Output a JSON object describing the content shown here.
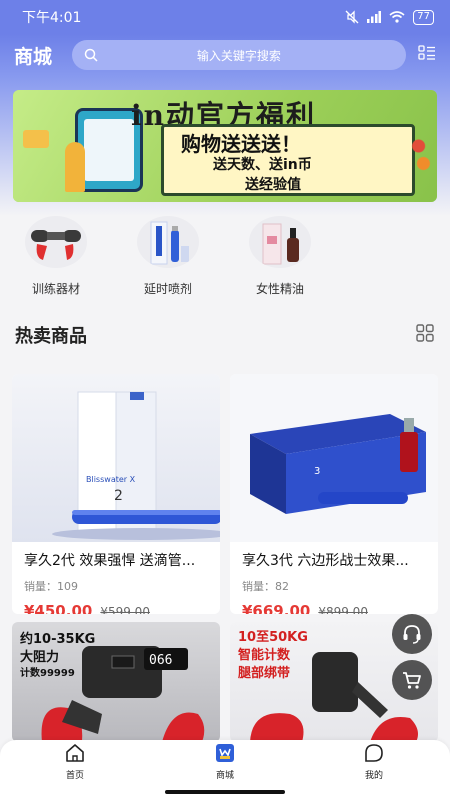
{
  "status_bar": {
    "time": "下午4:01",
    "battery": "77"
  },
  "header": {
    "title": "商城",
    "search_placeholder": "输入关键字搜索"
  },
  "banner": {
    "title": "in动官方福利",
    "line1": "购物送送送！",
    "line2": "送天数、送in币",
    "line3": "送经验值"
  },
  "categories": [
    {
      "label": "训练器材",
      "icon": "training-equipment-image"
    },
    {
      "label": "延时喷剂",
      "icon": "delay-spray-image"
    },
    {
      "label": "女性精油",
      "icon": "female-oil-image"
    }
  ],
  "section": {
    "title": "热卖商品"
  },
  "products": [
    {
      "name": "享久2代 效果强悍 送滴管...",
      "sales": "销量：109",
      "price": "¥450.00",
      "original_price": "¥599.00",
      "box_text": "Blisswater X",
      "version": "2"
    },
    {
      "name": "享久3代 六边形战士效果...",
      "sales": "销量：82",
      "price": "¥669.00",
      "original_price": "¥899.00",
      "box_text": "3",
      "version": "3"
    }
  ],
  "promos": [
    {
      "line1": "约10-35KG",
      "line2": "大阻力",
      "line3": "计数99999",
      "display": "066"
    },
    {
      "line1": "10至50KG",
      "line2": "智能计数",
      "line3": "腿部绑带"
    }
  ],
  "tabbar": [
    {
      "label": "首页",
      "icon": "home-icon"
    },
    {
      "label": "商城",
      "icon": "shop-icon"
    },
    {
      "label": "我的",
      "icon": "profile-icon"
    }
  ],
  "colors": {
    "primary": "#6d80e8",
    "price": "#e53935"
  }
}
